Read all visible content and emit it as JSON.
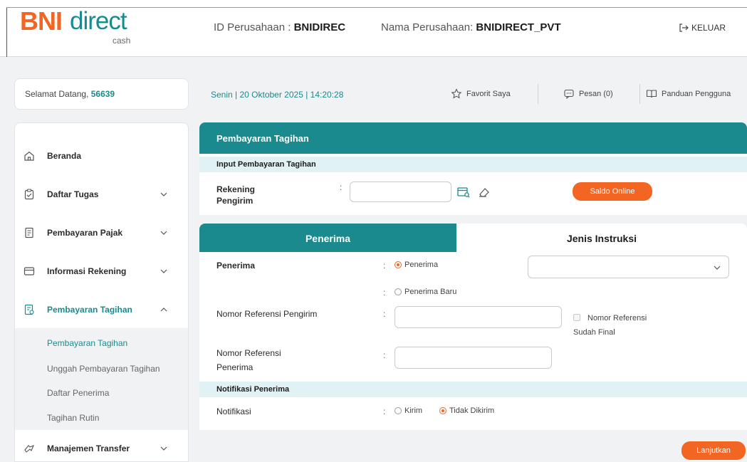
{
  "header": {
    "logo_bni": "BNI",
    "logo_direct": "direct",
    "logo_cash": "cash",
    "company_id_label": "ID Perusahaan : ",
    "company_id": "BNIDIREC",
    "company_name_label": "Nama Perusahaan: ",
    "company_name": "BNIDIRECT_PVT",
    "logout": "KELUAR"
  },
  "welcome": {
    "label": "Selamat Datang, ",
    "user_id": "56639"
  },
  "datebar": {
    "date": "Senin  |  20 Oktober 2025  |  14:20:28",
    "favorite": "Favorit Saya",
    "messages": "Pesan (0)",
    "guide": "Panduan Pengguna"
  },
  "sidebar": {
    "items": [
      {
        "label": "Beranda"
      },
      {
        "label": "Daftar Tugas"
      },
      {
        "label": "Pembayaran Pajak"
      },
      {
        "label": "Informasi Rekening"
      },
      {
        "label": "Pembayaran Tagihan"
      },
      {
        "label": "Manajemen Transfer"
      }
    ],
    "submenu": [
      {
        "label": "Pembayaran Tagihan"
      },
      {
        "label": "Unggah Pembayaran Tagihan"
      },
      {
        "label": "Daftar Penerima"
      },
      {
        "label": "Tagihan Rutin"
      }
    ]
  },
  "panel": {
    "title": "Pembayaran Tagihan",
    "section_input": "Input Pembayaran Tagihan",
    "sender_account_label": "Rekening Pengirim",
    "colon": ":",
    "sender_account_value": "",
    "balance_button": "Saldo Online"
  },
  "recipient_panel": {
    "tab_recipient": "Penerima",
    "tab_instruction": "Jenis Instruksi",
    "recipient_label": "Penerima",
    "radio_recipient": "Penerima",
    "radio_new_recipient": "Penerima Baru",
    "recipient_select_value": "",
    "sender_ref_label": "Nomor Referensi Pengirim",
    "sender_ref_value": "",
    "final_ref_checkbox_1": "Nomor Referensi",
    "final_ref_checkbox_2": "Sudah Final",
    "recipient_ref_label_1": "Nomor Referensi",
    "recipient_ref_label_2": "Penerima",
    "recipient_ref_value": "",
    "section_notification": "Notifikasi Penerima",
    "notification_label": "Notifikasi",
    "radio_send": "Kirim",
    "radio_not_send": "Tidak Dikirim"
  },
  "continue_button": "Lanjutkan",
  "colors": {
    "teal": "#1a8a8e",
    "orange": "#f26522",
    "light_teal": "#e1f2f4"
  }
}
